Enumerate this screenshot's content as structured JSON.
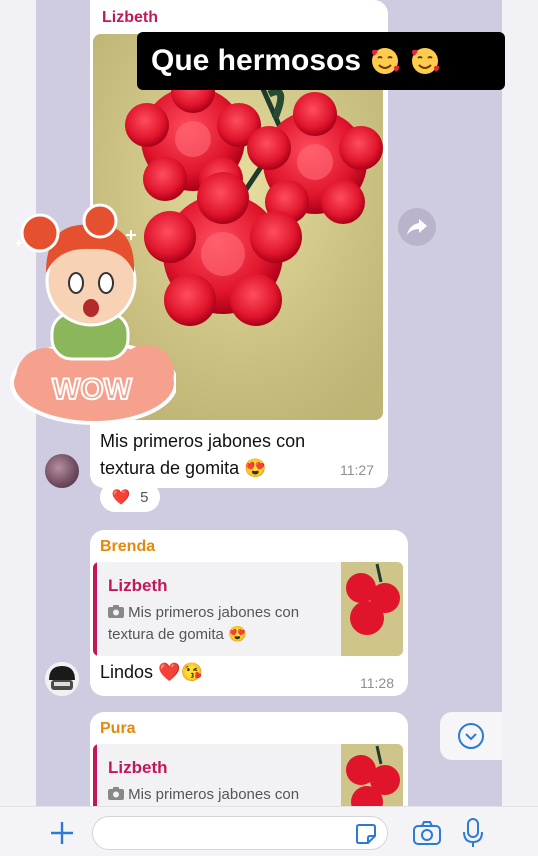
{
  "story_overlay": {
    "text": "Que hermosos",
    "emojis": [
      "smiling-face-with-hearts",
      "smiling-face-with-hearts"
    ]
  },
  "messages": [
    {
      "sender": "Lizbeth",
      "sender_color": "#c2185b",
      "caption": "Mis primeros jabones con textura de gomita 😍",
      "time": "11:27",
      "reaction": {
        "emoji": "❤️",
        "count": "5"
      }
    },
    {
      "sender": "Brenda",
      "sender_color": "#e6890a",
      "quoted": {
        "sender": "Lizbeth",
        "text": "Mis primeros jabones con textura de gomita 😍"
      },
      "text": "Lindos ❤️😘",
      "time": "11:28"
    },
    {
      "sender": "Pura",
      "sender_color": "#e6890a",
      "quoted": {
        "sender": "Lizbeth",
        "text": "Mis primeros jabones con"
      }
    }
  ],
  "sticker": {
    "text": "WOW"
  },
  "input": {
    "placeholder": ""
  },
  "icons": [
    "forward-icon",
    "chevron-down-icon",
    "plus-icon",
    "sticker-icon",
    "camera-icon",
    "microphone-icon",
    "photo-icon"
  ]
}
